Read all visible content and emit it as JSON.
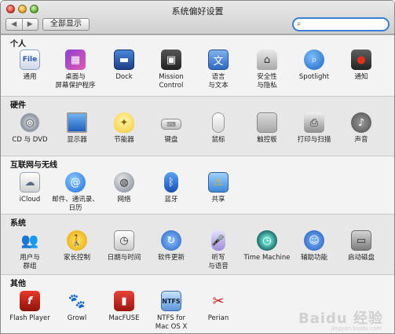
{
  "window": {
    "title": "系统偏好设置"
  },
  "toolbar": {
    "back_glyph": "◀",
    "forward_glyph": "▶",
    "show_all_label": "全部显示",
    "search_placeholder": "",
    "search_icon": "search-icon"
  },
  "sections": {
    "personal": {
      "title": "个人",
      "items": [
        {
          "label": "通用",
          "glyph": "File"
        },
        {
          "label": "桌面与\n屏幕保护程序",
          "glyph": "▦"
        },
        {
          "label": "Dock",
          "glyph": "▬"
        },
        {
          "label": "Mission\nControl",
          "glyph": "▣"
        },
        {
          "label": "语言\n与文本",
          "glyph": "文"
        },
        {
          "label": "安全性\n与隐私",
          "glyph": "⌂"
        },
        {
          "label": "Spotlight",
          "glyph": "⌕"
        },
        {
          "label": "通知",
          "glyph": "●"
        }
      ]
    },
    "hardware": {
      "title": "硬件",
      "items": [
        {
          "label": "CD 与 DVD",
          "glyph": "◎"
        },
        {
          "label": "显示器",
          "glyph": ""
        },
        {
          "label": "节能器",
          "glyph": "✦"
        },
        {
          "label": "键盘",
          "glyph": "⌨"
        },
        {
          "label": "鼠标",
          "glyph": ""
        },
        {
          "label": "触控板",
          "glyph": ""
        },
        {
          "label": "打印与扫描",
          "glyph": "⎙"
        },
        {
          "label": "声音",
          "glyph": "♪"
        }
      ]
    },
    "internet": {
      "title": "互联网与无线",
      "items": [
        {
          "label": "iCloud",
          "glyph": "☁"
        },
        {
          "label": "邮件、通讯录、\n日历",
          "glyph": "@"
        },
        {
          "label": "网络",
          "glyph": "◍"
        },
        {
          "label": "蓝牙",
          "glyph": "ᛒ"
        },
        {
          "label": "共享",
          "glyph": "⚠"
        }
      ]
    },
    "system": {
      "title": "系统",
      "items": [
        {
          "label": "用户与\n群组",
          "glyph": "👥"
        },
        {
          "label": "家长控制",
          "glyph": "🚶"
        },
        {
          "label": "日期与时间",
          "glyph": "◷"
        },
        {
          "label": "软件更新",
          "glyph": "↻"
        },
        {
          "label": "听写\n与语音",
          "glyph": "🎤"
        },
        {
          "label": "Time Machine",
          "glyph": "◷"
        },
        {
          "label": "辅助功能",
          "glyph": "☺"
        },
        {
          "label": "启动磁盘",
          "glyph": "▭"
        }
      ]
    },
    "other": {
      "title": "其他",
      "items": [
        {
          "label": "Flash Player",
          "glyph": "f"
        },
        {
          "label": "Growl",
          "glyph": "🐾"
        },
        {
          "label": "MacFUSE",
          "glyph": "▮"
        },
        {
          "label": "NTFS for\nMac OS X",
          "glyph": "NTFS"
        },
        {
          "label": "Perian",
          "glyph": "✂"
        }
      ]
    }
  },
  "watermark": {
    "text": "Baidu 经验",
    "sub": "jingyan.baidu.com"
  }
}
